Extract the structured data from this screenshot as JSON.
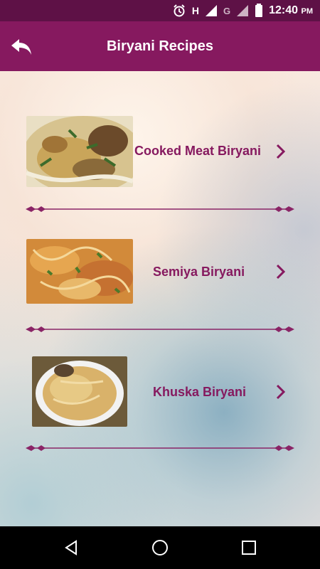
{
  "status_bar": {
    "time": "12:40",
    "ampm": "PM",
    "network_h": "H",
    "network_g": "G",
    "icons": [
      "alarm-icon",
      "signal-icon",
      "signal-icon",
      "battery-icon"
    ]
  },
  "app_bar": {
    "title": "Biryani Recipes",
    "back_icon": "back-arrow-icon"
  },
  "recipes": [
    {
      "label": "Cooked Meat Biryani",
      "icon": "chevron-right-icon"
    },
    {
      "label": "Semiya Biryani",
      "icon": "chevron-right-icon"
    },
    {
      "label": "Khuska Biryani",
      "icon": "chevron-right-icon"
    }
  ],
  "colors": {
    "primary": "#86195f",
    "status_bar": "#5e1146",
    "nav_bar": "#000000"
  },
  "nav_bar": {
    "icons": [
      "back-triangle-icon",
      "home-circle-icon",
      "recents-square-icon"
    ]
  }
}
